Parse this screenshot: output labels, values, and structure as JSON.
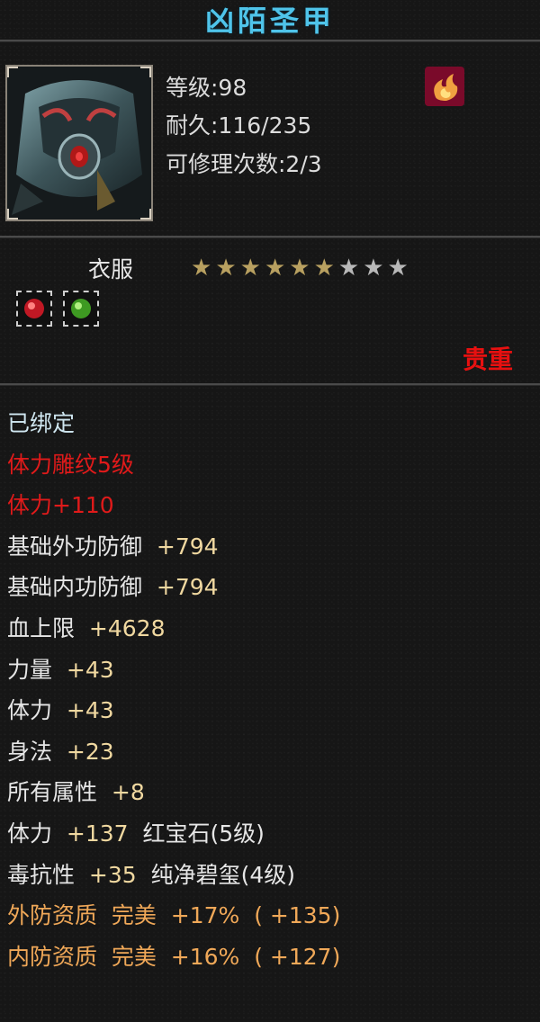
{
  "item": {
    "name": "凶陌圣甲",
    "level": "等级:98",
    "durability": "耐久:116/235",
    "repairs": "可修理次数:2/3",
    "slot": "衣服",
    "stars_total": 9,
    "stars_filled": 6,
    "rarity": "贵重",
    "class_icon": "flame-class-icon"
  },
  "gems": [
    {
      "name": "red-gem-icon",
      "color": "#d0202a"
    },
    {
      "name": "green-gem-icon",
      "color": "#4aa82a"
    }
  ],
  "attributes": [
    {
      "label": "已绑定",
      "value": "",
      "extra": "",
      "style": "bind"
    },
    {
      "label": "体力雕纹5级",
      "value": "",
      "extra": "",
      "style": "red"
    },
    {
      "label": "体力+110",
      "value": "",
      "extra": "",
      "style": "red"
    },
    {
      "label": "基础外功防御",
      "value": "+794",
      "extra": "",
      "style": "white"
    },
    {
      "label": "基础内功防御",
      "value": "+794",
      "extra": "",
      "style": "white"
    },
    {
      "label": "血上限",
      "value": "+4628",
      "extra": "",
      "style": "white"
    },
    {
      "label": "力量",
      "value": "+43",
      "extra": "",
      "style": "white"
    },
    {
      "label": "体力",
      "value": "+43",
      "extra": "",
      "style": "white"
    },
    {
      "label": "身法",
      "value": "+23",
      "extra": "",
      "style": "white"
    },
    {
      "label": "所有属性",
      "value": "+8",
      "extra": "",
      "style": "white"
    },
    {
      "label": "体力",
      "value": "+137",
      "extra": "红宝石(5级)",
      "style": "white"
    },
    {
      "label": "毒抗性",
      "value": "+35",
      "extra": "纯净碧玺(4级)",
      "style": "white"
    },
    {
      "label": "外防资质",
      "value": "完美  +17%",
      "extra": "( +135)",
      "style": "orange"
    },
    {
      "label": "内防资质",
      "value": "完美  +16%",
      "extra": "( +127)",
      "style": "orange"
    }
  ],
  "colors": {
    "title": "#4fc4ea",
    "rarity": "#e81010",
    "star_filled": "#b8a060",
    "star_empty": "#b8b8b8"
  }
}
